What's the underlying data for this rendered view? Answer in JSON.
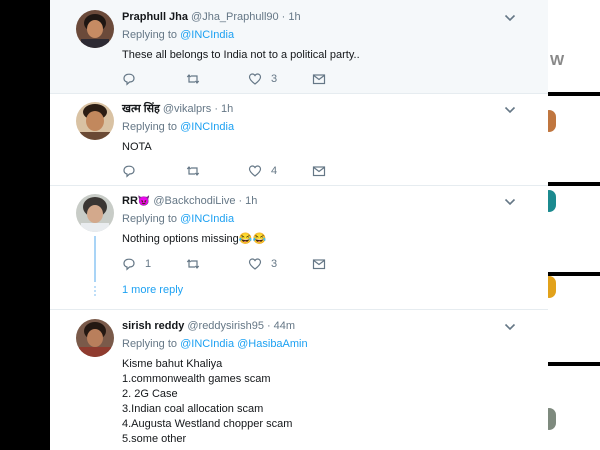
{
  "side": {
    "fragment_letter": "W"
  },
  "tweets": [
    {
      "name": "Praphull Jha",
      "handle": "@Jha_Praphull90",
      "separator": "·",
      "time": "1h",
      "replying_label": "Replying to",
      "mentions": [
        "@INCIndia"
      ],
      "text_lines": [
        "These all belongs to India not to a political party.."
      ],
      "reply_count": "",
      "retweet_count": "",
      "like_count": "3"
    },
    {
      "name": "खत्म सिंह",
      "handle": "@vikalprs",
      "separator": "·",
      "time": "1h",
      "replying_label": "Replying to",
      "mentions": [
        "@INCIndia"
      ],
      "text_lines": [
        "NOTA"
      ],
      "reply_count": "",
      "retweet_count": "",
      "like_count": "4"
    },
    {
      "name": "RR",
      "name_emoji": "😈",
      "handle": "@BackchodiLive",
      "separator": "·",
      "time": "1h",
      "replying_label": "Replying to",
      "mentions": [
        "@INCIndia"
      ],
      "text_lines": [
        "Nothing options missing"
      ],
      "text_emoji": "😂😂",
      "reply_count": "1",
      "retweet_count": "",
      "like_count": "3",
      "more_replies": "1 more reply"
    },
    {
      "name": "sirish reddy",
      "handle": "@reddysirish95",
      "separator": "·",
      "time": "44m",
      "replying_label": "Replying to",
      "mentions": [
        "@INCIndia",
        "@HasibaAmin"
      ],
      "text_lines": [
        "Kisme bahut Khaliya",
        "1.commonwealth games scam",
        "2. 2G Case",
        "3.Indian coal allocation scam",
        "4.Augusta Westland chopper scam",
        "5.some other"
      ]
    }
  ],
  "colors": {
    "accent": "#1da1f2",
    "muted": "#657786",
    "text": "#14171a",
    "highlight_bg": "#f5f8fa",
    "thread_line": "#a9d4f6"
  },
  "icons": {
    "reply": "reply-icon",
    "retweet": "retweet-icon",
    "like": "heart-icon",
    "dm": "envelope-icon",
    "menu": "chevron-down-icon"
  }
}
